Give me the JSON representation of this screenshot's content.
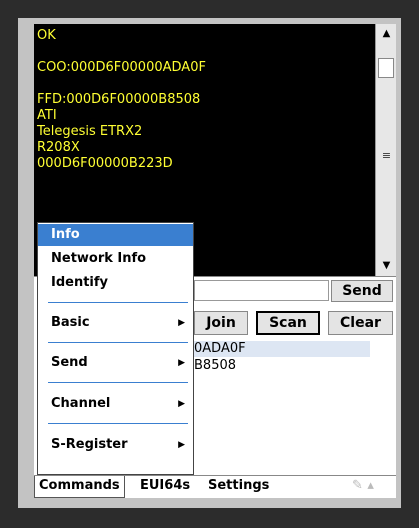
{
  "console": {
    "lines": [
      "OK",
      "",
      "COO:000D6F00000ADA0F",
      "",
      "FFD:000D6F00000B8508",
      "ATI",
      "Telegesis ETRX2",
      "R208X",
      "000D6F00000B223D"
    ]
  },
  "toolbar": {
    "send_label": "Send",
    "join_label": "Join",
    "scan_label": "Scan",
    "clear_label": "Clear"
  },
  "devices": {
    "rows": [
      "0ADA0F",
      "B8508"
    ]
  },
  "context_menu": {
    "items": [
      {
        "label": "Info",
        "submenu": false
      },
      {
        "label": "Network Info",
        "submenu": false
      },
      {
        "label": "Identify",
        "submenu": false
      },
      {
        "label": "Basic",
        "submenu": true
      },
      {
        "label": "Send",
        "submenu": true
      },
      {
        "label": "Channel",
        "submenu": true
      },
      {
        "label": "S-Register",
        "submenu": true
      }
    ],
    "submenu_glyph": "▶"
  },
  "tabs": {
    "commands": "Commands",
    "eui64s": "EUI64s",
    "settings": "Settings"
  },
  "icons": {
    "scroll_up": "▲",
    "scroll_down": "▼",
    "scroll_grip": "≡",
    "pen": "✎ ▴"
  },
  "colors": {
    "console_text": "#ffff33",
    "menu_highlight": "#3a7fd0"
  }
}
